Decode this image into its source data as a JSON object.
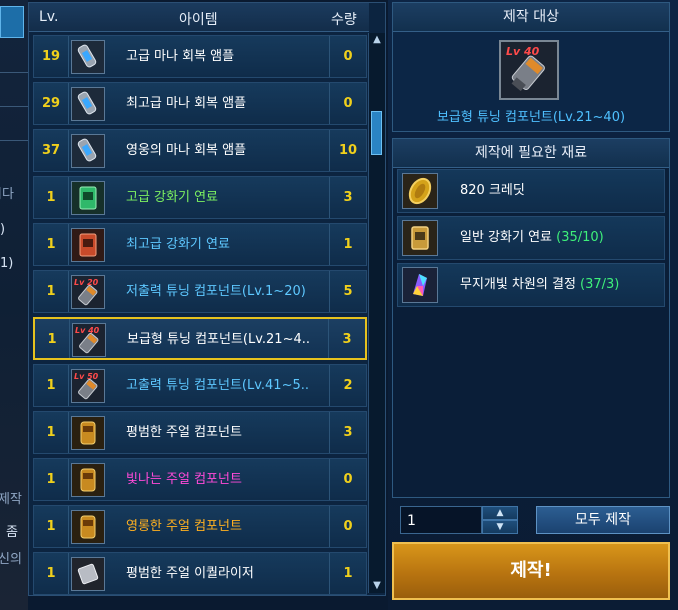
{
  "background": {
    "fragments": [
      "니다",
      ")",
      "1)",
      "제작",
      "좀",
      "신의"
    ]
  },
  "list": {
    "header": {
      "lv": "Lv.",
      "item": "아이템",
      "qty": "수량"
    },
    "items": [
      {
        "lv": "19",
        "name": "고급 마나 회복 앰플",
        "qty": "0",
        "name_color": "#ffffff",
        "icon": "mana-ampoule-icon"
      },
      {
        "lv": "29",
        "name": "최고급 마나 회복 앰플",
        "qty": "0",
        "name_color": "#ffffff",
        "icon": "mana-ampoule-icon"
      },
      {
        "lv": "37",
        "name": "영웅의 마나 회복 앰플",
        "qty": "10",
        "name_color": "#ffffff",
        "icon": "mana-ampoule-icon"
      },
      {
        "lv": "1",
        "name": "고급 강화기 연료",
        "qty": "3",
        "name_color": "#7cf060",
        "icon": "green-fuel-icon"
      },
      {
        "lv": "1",
        "name": "최고급 강화기 연료",
        "qty": "1",
        "name_color": "#5ec8ff",
        "icon": "red-fuel-icon"
      },
      {
        "lv": "1",
        "name": "저출력 튜닝 컴포넌트(Lv.1~20)",
        "qty": "5",
        "name_color": "#5ec8ff",
        "icon": "tuning-component-icon",
        "badge": "Lv 20"
      },
      {
        "lv": "1",
        "name": "보급형 튜닝 컴포넌트(Lv.21~4..",
        "qty": "3",
        "name_color": "#ffffff",
        "icon": "tuning-component-icon",
        "badge": "Lv 40",
        "selected": true
      },
      {
        "lv": "1",
        "name": "고출력 튜닝 컴포넌트(Lv.41~5..",
        "qty": "2",
        "name_color": "#5ec8ff",
        "icon": "tuning-component-icon",
        "badge": "Lv 50"
      },
      {
        "lv": "1",
        "name": "평범한 주얼 컴포넌트",
        "qty": "3",
        "name_color": "#ffffff",
        "icon": "jewel-component-icon"
      },
      {
        "lv": "1",
        "name": "빛나는 주얼 컴포넌트",
        "qty": "0",
        "name_color": "#ff4ad8",
        "icon": "jewel-component-icon"
      },
      {
        "lv": "1",
        "name": "영롱한 주얼 컴포넌트",
        "qty": "0",
        "name_color": "#ffb020",
        "icon": "jewel-component-icon"
      },
      {
        "lv": "1",
        "name": "평범한 주얼 이퀄라이저",
        "qty": "1",
        "name_color": "#ffffff",
        "icon": "jewel-equalizer-icon"
      }
    ]
  },
  "target": {
    "title": "제작 대상",
    "badge": "Lv 40",
    "name": "보급형 튜닝 컴포넌트(Lv.21~40)"
  },
  "materials": {
    "title": "제작에 필요한 재료",
    "items": [
      {
        "label": "820 크레딧",
        "count": "",
        "icon": "credit-coin-icon"
      },
      {
        "label": "일반 강화기 연료 ",
        "count": "(35/10)",
        "icon": "normal-fuel-icon"
      },
      {
        "label": "무지개빛 차원의 결정 ",
        "count": "(37/3)",
        "icon": "rainbow-crystal-icon"
      }
    ]
  },
  "controls": {
    "quantity": "1",
    "craft_all": "모두 제작",
    "craft": "제작!"
  },
  "colors": {
    "level": "#f0d01c",
    "selected_border": "#e6c21e",
    "target_name": "#4fc0ff",
    "count_ok": "#3ef07a",
    "craft_button": "#c8861a"
  }
}
